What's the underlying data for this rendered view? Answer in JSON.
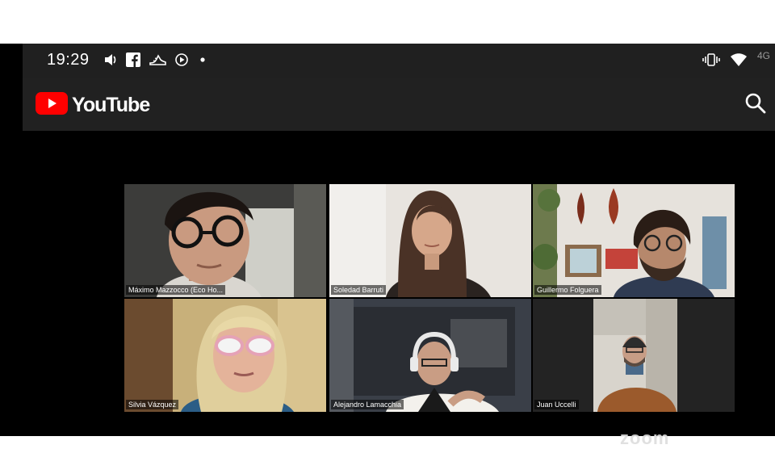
{
  "status_bar": {
    "time": "19:29",
    "left_icons": [
      "volume-icon",
      "facebook-icon",
      "shoe-icon",
      "play-circle-icon",
      "dot-icon"
    ],
    "right_icons": [
      "vibrate-icon",
      "wifi-icon"
    ],
    "network": "4G"
  },
  "app_bar": {
    "logo_text": "YouTube",
    "brand_color": "#ff0000",
    "search_icon": "search-icon"
  },
  "meeting": {
    "active_color": "#46d11e",
    "participants": [
      {
        "name": "Máximo Mazzocco (Eco Ho...",
        "active": false
      },
      {
        "name": "Soledad Barruti",
        "active": false
      },
      {
        "name": "Guillermo Folguera",
        "active": true
      },
      {
        "name": "Silvia Vázquez",
        "active": false
      },
      {
        "name": "Alejandro Lamacchia",
        "active": false
      },
      {
        "name": "Juan Uccelli",
        "active": false
      }
    ],
    "watermark": "zoom"
  }
}
